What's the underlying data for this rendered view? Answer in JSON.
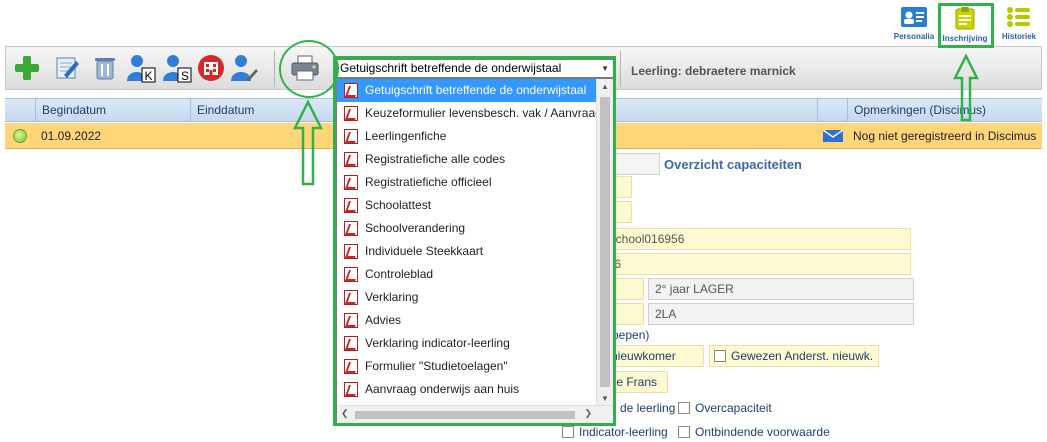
{
  "nav": {
    "personalia": "Personalia",
    "inschrijving": "Inschrijving",
    "historiek": "Historiek"
  },
  "toolbar": {
    "dropdown_value": "Getuigschrift betreffende de onderwijstaal",
    "pupil_label": "Leerling: debraetere marnick",
    "icon_k": "K",
    "icon_s": "S"
  },
  "grid": {
    "headers": [
      "Begindatum",
      "Einddatum",
      "Opmerkingen (Discimus)"
    ],
    "row": {
      "begindatum": "01.09.2022",
      "opmerking": "Nog niet geregistreerd in Discimus"
    }
  },
  "dropdown": {
    "items": [
      "Getuigschrift betreffende de onderwijstaal",
      "Keuzeformulier levensbesch. vak / Aanvraag",
      "Leerlingenfiche",
      "Registratiefiche alle codes",
      "Registratiefiche officieel",
      "Schoolattest",
      "Schoolverandering",
      "Individuele Steekkaart",
      "Controleblad",
      "Verklaring",
      "Advies",
      "Verklaring indicator-leerling",
      "Formulier \"Studietoelagen\"",
      "Aanvraag onderwijs aan huis"
    ],
    "selected_index": 0
  },
  "form": {
    "overzicht": "Overzicht capaciteiten",
    "school_partial": "isschool016956",
    "num_partial": "636",
    "jaar": "2° jaar LAGER",
    "klas": "2LA",
    "groepen_partial": "roepen)",
    "nieuwkomer_partial": "t. nieuwkomer",
    "gewezen": "Gewezen Anderst. nieuwk.",
    "frans_partial": "iatie Frans",
    "leerling_partial": "de leerling",
    "overcapaciteit": "Overcapaciteit",
    "indicator": "Indicator-leerling",
    "ontbindende": "Ontbindende voorwaarde"
  },
  "colors": {
    "highlight": "#2fb24a",
    "selected_row": "#ffd57a",
    "selection": "#3399ff"
  }
}
